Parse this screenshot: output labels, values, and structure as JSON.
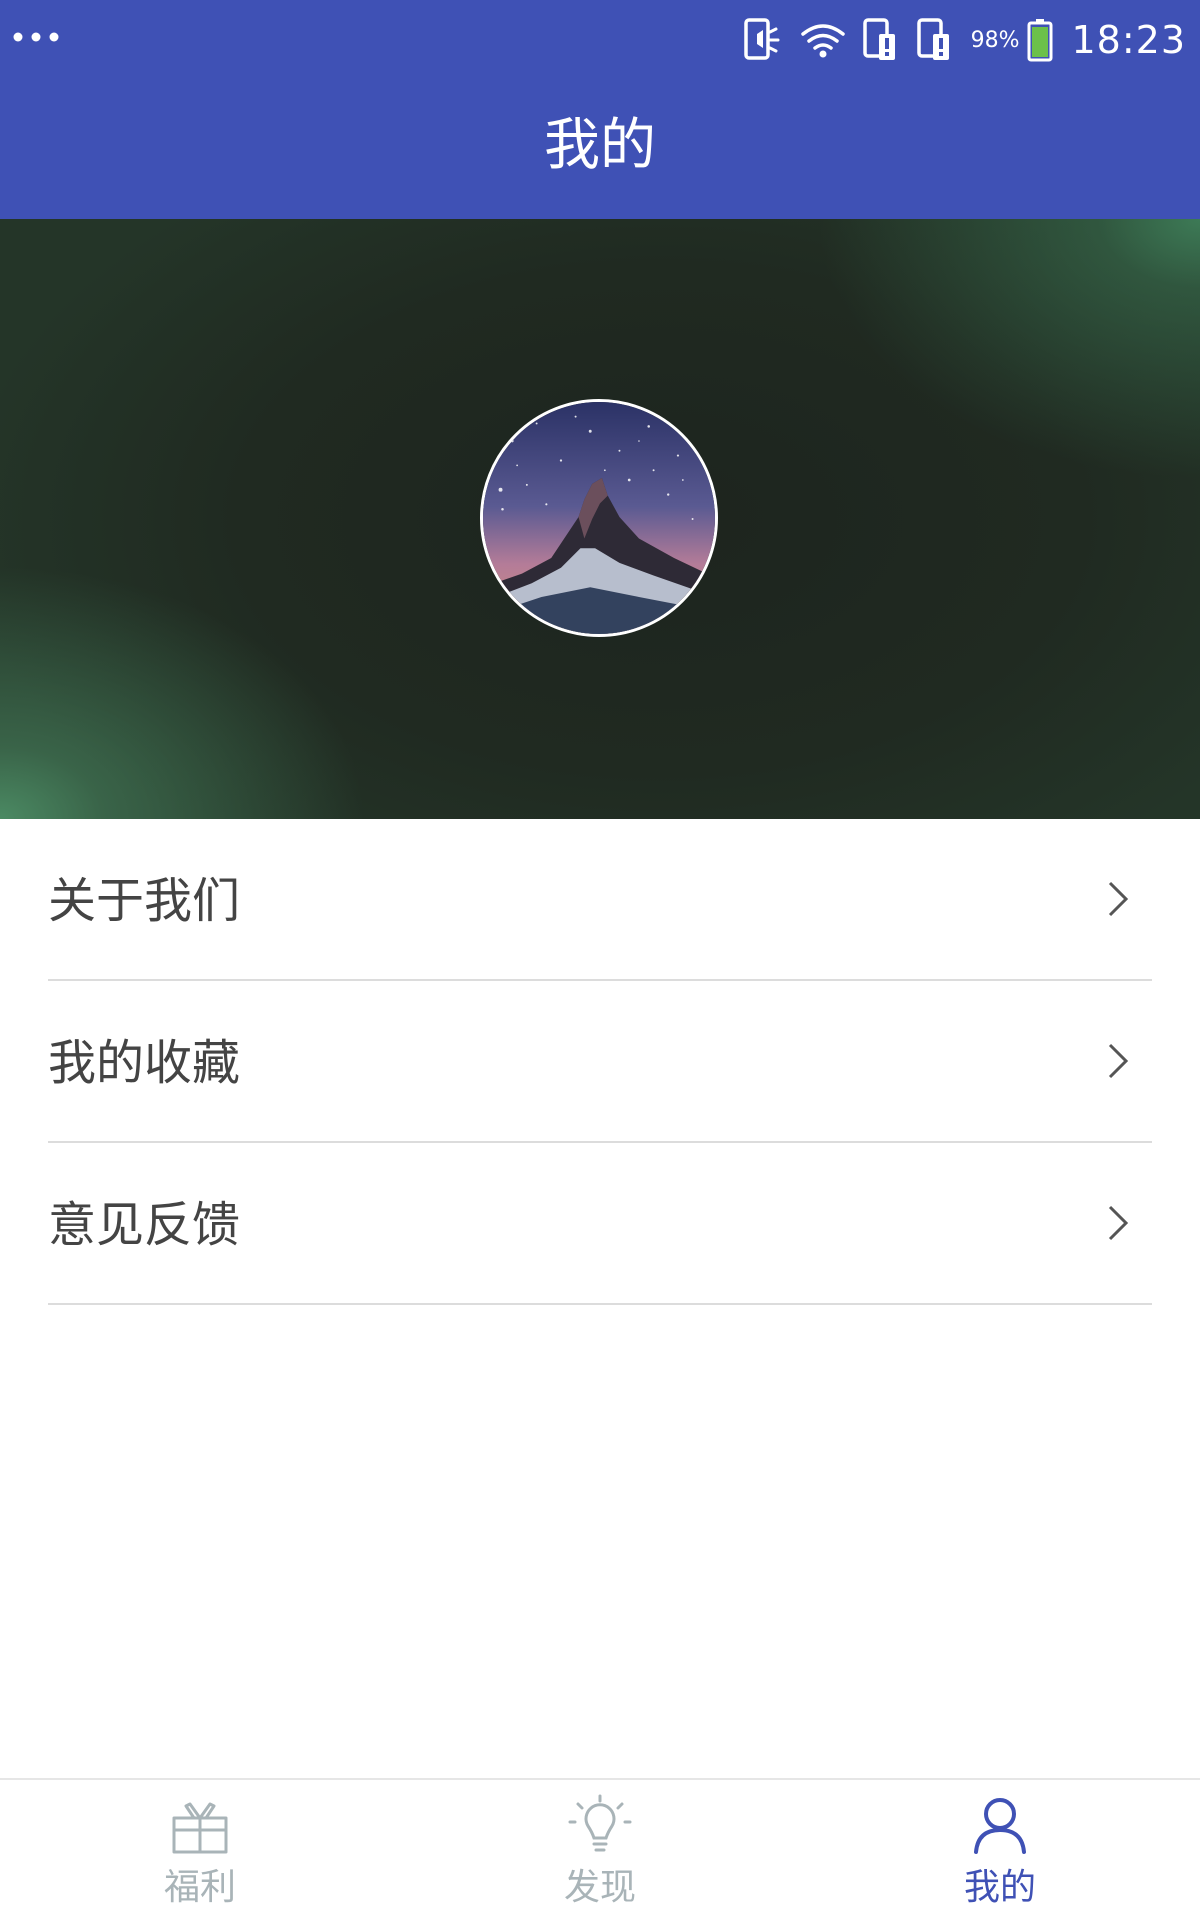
{
  "status_bar": {
    "battery_percent": "98%",
    "time": "18:23"
  },
  "header": {
    "title": "我的"
  },
  "menu": {
    "items": [
      {
        "label": "关于我们"
      },
      {
        "label": "我的收藏"
      },
      {
        "label": "意见反馈"
      }
    ]
  },
  "bottom_nav": {
    "items": [
      {
        "label": "福利",
        "icon": "gift-icon",
        "active": false
      },
      {
        "label": "发现",
        "icon": "lightbulb-icon",
        "active": false
      },
      {
        "label": "我的",
        "icon": "user-icon",
        "active": true
      }
    ]
  },
  "colors": {
    "primary": "#3f51b5",
    "inactive_nav": "#a9b4b8",
    "menu_text": "#444444",
    "divider": "#dcdcdc"
  }
}
